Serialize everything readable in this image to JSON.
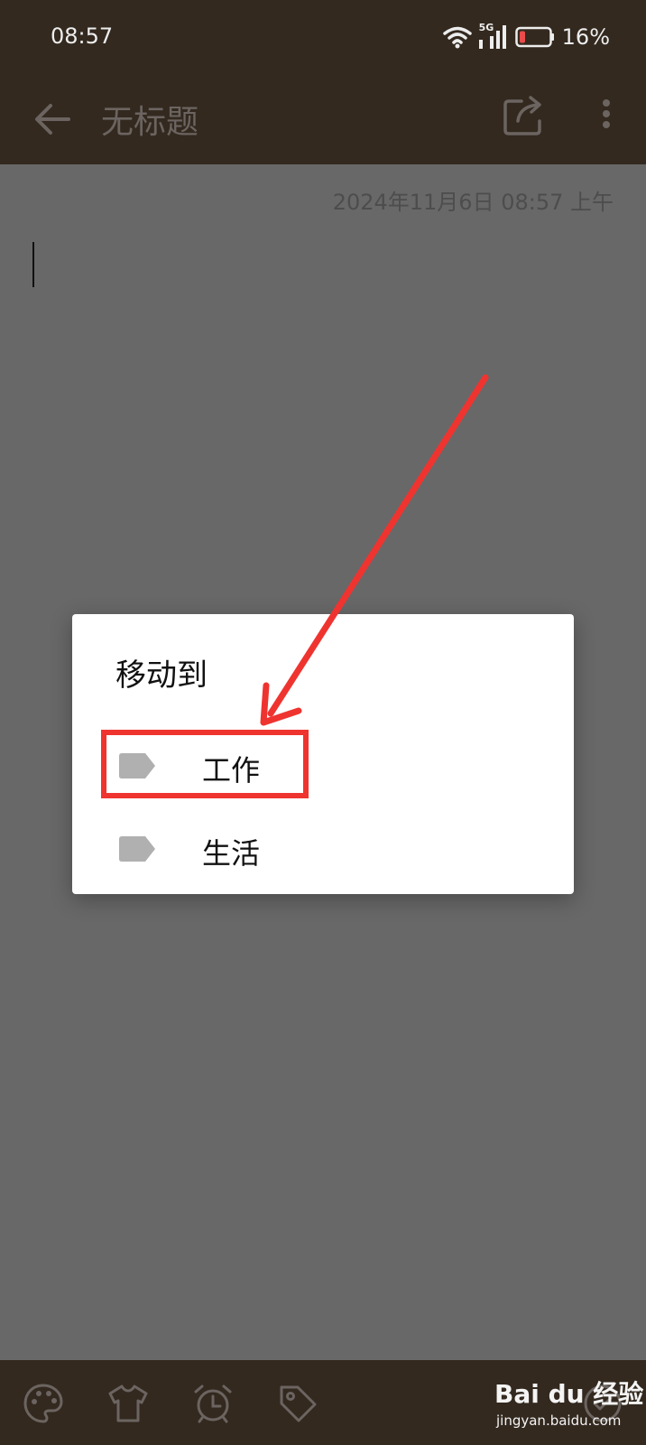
{
  "status_bar": {
    "time": "08:57",
    "network": "5G",
    "battery": "16%"
  },
  "app_bar": {
    "title": "无标题",
    "icons": [
      "back-arrow-icon",
      "share-icon",
      "more-vertical-icon"
    ]
  },
  "note": {
    "date": "2024年11月6日 08:57 上午"
  },
  "dialog": {
    "title": "移动到",
    "options": [
      {
        "label": "工作",
        "icon": "tag-icon",
        "highlighted": true
      },
      {
        "label": "生活",
        "icon": "tag-icon",
        "highlighted": false
      }
    ]
  },
  "bottom_bar": {
    "icons": [
      "palette-icon",
      "shirt-icon",
      "alarm-icon",
      "tag-icon",
      "check-circle-icon"
    ]
  },
  "watermark": {
    "logo": "Bai du 经验",
    "url": "jingyan.baidu.com"
  },
  "colors": {
    "bar": "#33291f",
    "scrim": "#686868",
    "highlight": "#ef3430",
    "tag": "#b0b0b0"
  }
}
